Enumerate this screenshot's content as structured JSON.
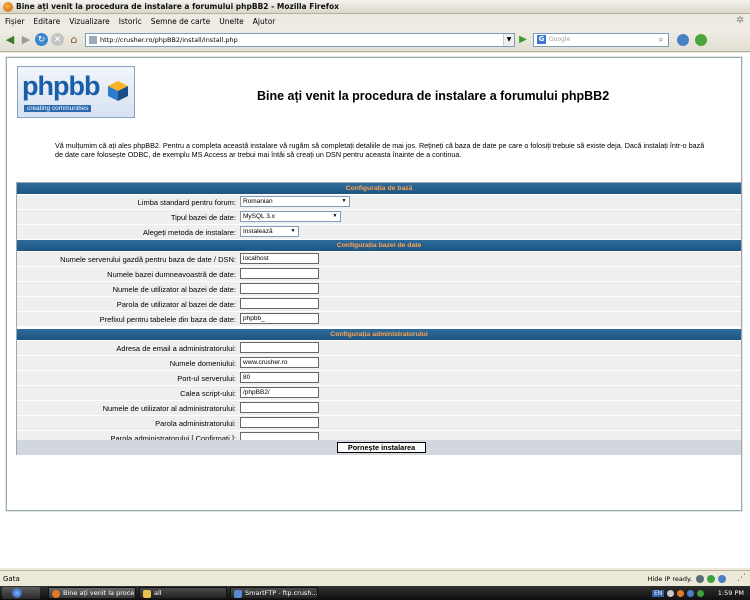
{
  "window": {
    "title": "Bine ați venit la procedura de instalare a forumului phpBB2 - Mozilla Firefox"
  },
  "menu": [
    "Fișier",
    "Editare",
    "Vizualizare",
    "Istoric",
    "Semne de carte",
    "Unelte",
    "Ajutor"
  ],
  "nav": {
    "url": "http://crusher.ro/phpBB2/install/install.php",
    "search_placeholder": "Google"
  },
  "page": {
    "logo": {
      "wordmark": "phpbb",
      "tagline": "creating communities"
    },
    "heading": "Bine ați venit la procedura de instalare a forumului phpBB2",
    "intro": "Vă mulțumim că ați ales phpBB2. Pentru a completa această instalare vă rugăm să completați detaliile de mai jos. Rețineți că baza de date pe care o folosiți trebuie să existe deja. Dacă instalați într-o bază de date care folosește ODBC, de exemplu MS Access ar trebui mai întâi să creați un DSN pentru aceasta înainte de a continua.",
    "sections": {
      "basic": {
        "title": "Configurația de bază",
        "fields": [
          {
            "label": "Limba standard pentru forum:",
            "value": "Romanian"
          },
          {
            "label": "Tipul bazei de date:",
            "value": "MySQL 3.x"
          },
          {
            "label": "Alegeți metoda de instalare:",
            "value": "Instalează"
          }
        ]
      },
      "database": {
        "title": "Configurația bazei de date",
        "fields": [
          {
            "label": "Numele serverului gazdă pentru baza de date / DSN:",
            "value": "localhost"
          },
          {
            "label": "Numele bazei dumneavoastră de date:",
            "value": ""
          },
          {
            "label": "Numele de utilizator al bazei de date:",
            "value": ""
          },
          {
            "label": "Parola de utilizator al bazei de date:",
            "value": ""
          },
          {
            "label": "Prefixul pentru tabelele din baza de date:",
            "value": "phpbb_"
          }
        ]
      },
      "admin": {
        "title": "Configurația administratorului",
        "fields": [
          {
            "label": "Adresa de email a administratorului:",
            "value": ""
          },
          {
            "label": "Numele domeniului:",
            "value": "www.crusher.ro"
          },
          {
            "label": "Port-ul serverului:",
            "value": "80"
          },
          {
            "label": "Calea script-ului:",
            "value": "/phpBB2/"
          },
          {
            "label": "Numele de utilizator al administratorului:",
            "value": ""
          },
          {
            "label": "Parola administratorului:",
            "value": ""
          },
          {
            "label": "Parola administratorului [ Confirmați ]:",
            "value": ""
          }
        ]
      }
    },
    "submit_label": "Pornește instalarea"
  },
  "status": {
    "text": "Gata",
    "hide_ip": "Hide IP ready."
  },
  "taskbar": {
    "tasks": [
      "Bine ați venit la proce...",
      "all",
      "SmartFTP - ftp.crush..."
    ],
    "lang": "EN",
    "clock": "1:59 PM"
  }
}
